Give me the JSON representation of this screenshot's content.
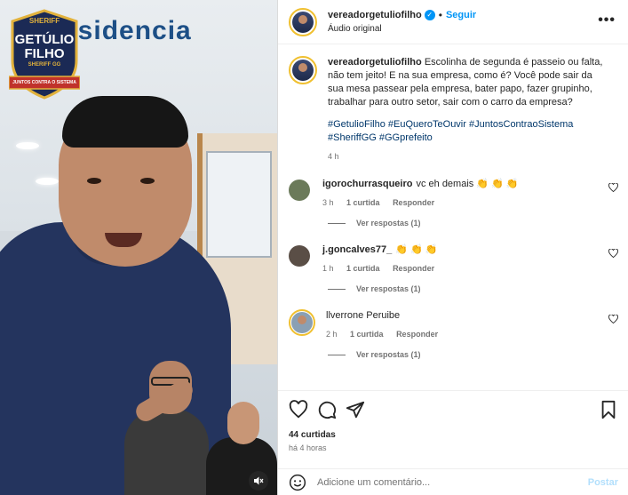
{
  "media": {
    "sign_text": "esidencia",
    "badge": {
      "top": "SHERIFF",
      "name_line1": "GETÚLIO",
      "name_line2": "FILHO",
      "sub": "SHERIFF GG",
      "ribbon": "JUNTOS CONTRA O SISTEMA"
    },
    "mute_icon": "speaker-muted-icon"
  },
  "header": {
    "username": "vereadorgetuliofilho",
    "follow_label": "Seguir",
    "separator": "•",
    "audio_label": "Áudio original",
    "more_icon": "more-horizontal-icon"
  },
  "caption": {
    "username": "vereadorgetuliofilho",
    "text": "Escolinha de segunda é passeio ou falta, não tem jeito! E na sua empresa, como é? Você pode sair da sua mesa passear pela empresa, bater papo, fazer grupinho, trabalhar para outro setor, sair com o carro da empresa?",
    "hashtags": "#GetulioFilho #EuQueroTeOuvir #JuntosContraoSistema #SheriffGG #GGprefeito",
    "time": "4 h"
  },
  "comments": [
    {
      "username": "igorochurrasqueiro",
      "text": "vc eh demais 👏 👏 👏",
      "time": "3 h",
      "likes": "1 curtida",
      "reply_label": "Responder",
      "view_replies": "Ver respostas (1)",
      "avatar_color": "#6b7a5a"
    },
    {
      "username": "j.goncalves77_",
      "text": "👏 👏 👏",
      "time": "1 h",
      "likes": "1 curtida",
      "reply_label": "Responder",
      "view_replies": "Ver respostas (1)",
      "avatar_color": "#5a4e46"
    },
    {
      "username": "llverrone Peruibe",
      "text": "",
      "time": "2 h",
      "likes": "1 curtida",
      "reply_label": "Responder",
      "view_replies": "Ver respostas (1)",
      "avatar_color": "#8aa0b4"
    }
  ],
  "actions": {
    "like_icon": "heart-icon",
    "comment_icon": "comment-icon",
    "share_icon": "share-icon",
    "save_icon": "bookmark-icon",
    "likes": "44 curtidas",
    "time_ago": "há 4 horas"
  },
  "add_comment": {
    "emoji_icon": "emoji-icon",
    "placeholder": "Adicione um comentário...",
    "post_label": "Postar"
  },
  "colors": {
    "accent": "#0095f6",
    "story_ring": "#f0c030",
    "muted_text": "#737373",
    "hashtag": "#00376b"
  }
}
